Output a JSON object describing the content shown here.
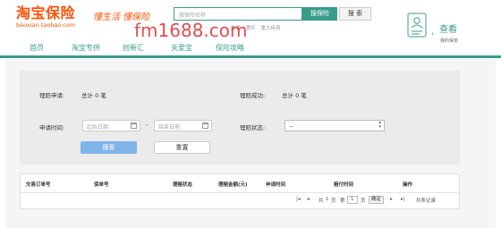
{
  "header": {
    "logo_main": "淘宝保险",
    "logo_sub": "baoxian.taobao.com",
    "slogan": "懂生活 懂保险",
    "watermark": "fm1688.com",
    "search_placeholder": "搜保险名称",
    "search_button": "搜保险",
    "search_button2": "搜 索",
    "hot_links": [
      "美景",
      "意疗",
      "重大疾病"
    ],
    "user_look": "查看",
    "user_sub": "我的保单"
  },
  "nav": {
    "items": [
      "首页",
      "淘宝专供",
      "创新汇",
      "关爱宝",
      "保险攻略"
    ]
  },
  "filter": {
    "claim_apply_label": "理赔申请:",
    "claim_apply_value": "总计 0 笔",
    "claim_success_label": "理赔成功:",
    "claim_success_value": "总计 0 笔",
    "apply_time_label": "申请时间:",
    "start_date_placeholder": "起始日期",
    "end_date_placeholder": "结束日期",
    "dash": "-",
    "claim_status_label": "理赔状态:",
    "claim_status_value": "--",
    "search_button": "搜索",
    "reset_button": "重置"
  },
  "table": {
    "headers": [
      "交易订单号",
      "保单号",
      "理赔状态",
      "理赔金额(元)",
      "申请时间",
      "赔付时间",
      "操作"
    ],
    "pager": {
      "total_prefix": "共",
      "total_pages": "1",
      "page_unit": "页",
      "goto_prefix": "第",
      "current_page": "1",
      "goto_unit": "页",
      "confirm": "确定",
      "record_total": "共条记录"
    }
  }
}
